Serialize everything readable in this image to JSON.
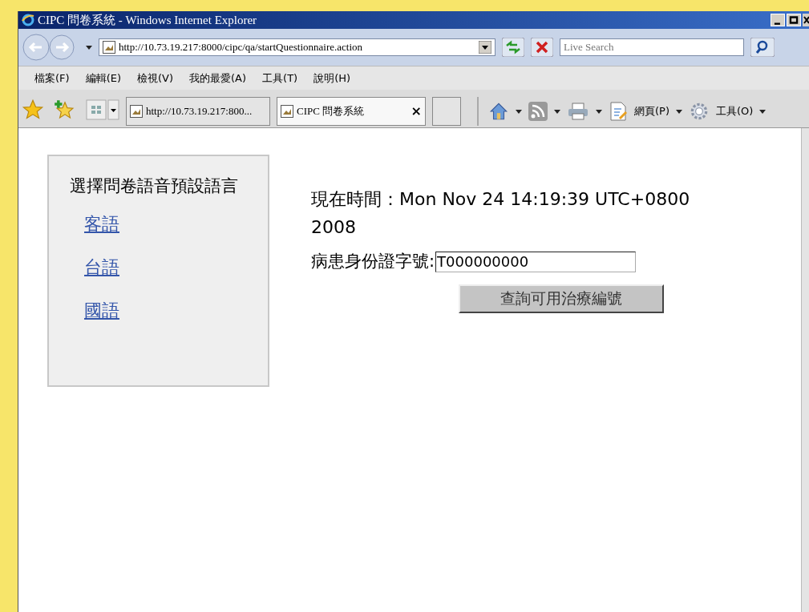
{
  "window": {
    "title": "CIPC 問卷系統 - Windows Internet Explorer"
  },
  "address_bar": {
    "url": "http://10.73.19.217:8000/cipc/qa/startQuestionnaire.action"
  },
  "search": {
    "placeholder": "Live Search"
  },
  "menu": [
    "檔案(F)",
    "編輯(E)",
    "檢視(V)",
    "我的最愛(A)",
    "工具(T)",
    "說明(H)"
  ],
  "tabs": [
    {
      "label": "http://10.73.19.217:800...",
      "selected": false
    },
    {
      "label": "CIPC 問卷系統",
      "selected": true,
      "close": "×"
    }
  ],
  "command_bar": [
    "網頁(P)",
    "工具(O)"
  ],
  "sidebar": {
    "title": "選擇問卷語音預設語言",
    "links": [
      "客語",
      "台語",
      "國語"
    ]
  },
  "time": {
    "label": "現在時間：",
    "value": "Mon Nov 24 14:19:39 UTC+0800 2008"
  },
  "patient_id": {
    "label": "病患身份證字號:",
    "value": "T000000000"
  },
  "query_button": "查詢可用治療編號"
}
